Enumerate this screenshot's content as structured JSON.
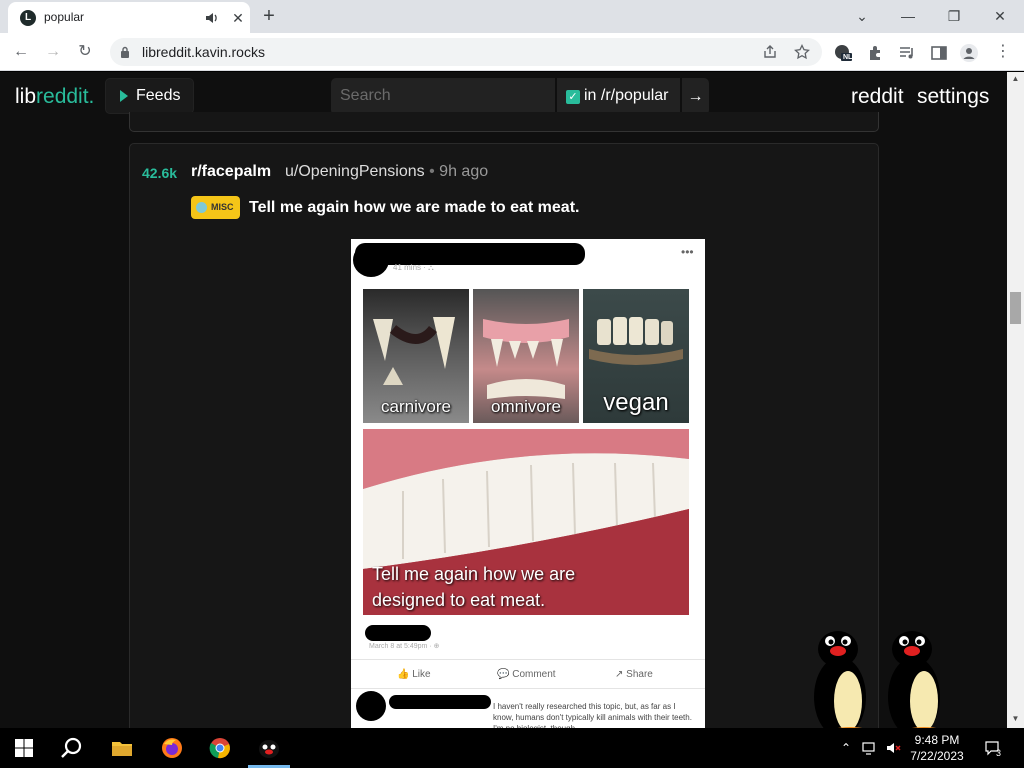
{
  "browser": {
    "tab_title": "popular",
    "tab_favicon_letter": "L",
    "url": "libreddit.kavin.rocks",
    "profile_badge": "NL"
  },
  "nav": {
    "logo_prefix": "lib",
    "logo_accent": "reddit.",
    "feeds_label": "Feeds",
    "search_placeholder": "Search",
    "restrict_label": "in /r/popular",
    "restrict_checked": true,
    "go_label": "→",
    "links": [
      "reddit",
      "settings"
    ]
  },
  "post": {
    "score": "42.6k",
    "subreddit": "r/facepalm",
    "author": "u/OpeningPensions",
    "separator": "•",
    "age": "9h ago",
    "flair": "MISC",
    "title": "Tell me again how we are made to eat meat."
  },
  "media": {
    "meta": "41 mins · ⛬",
    "cells": [
      "carnivore",
      "omnivore",
      "vegan"
    ],
    "caption_line1": "Tell me again how we are",
    "caption_line2": "designed to eat meat.",
    "date_line": "March 8 at 5:49pm · ⊕",
    "actions": [
      "Like",
      "Comment",
      "Share"
    ],
    "comment_text": "I haven't really researched this topic, but, as far as I know, humans don't typically kill animals with their teeth. I'm no biologist, though."
  },
  "taskbar": {
    "time": "9:48 PM",
    "date": "7/22/2023",
    "notification_count": "3"
  },
  "colors": {
    "accent": "#29bc9b",
    "page_bg": "#0f0f0f",
    "post_bg": "#161616",
    "flair_bg": "#f5c518"
  }
}
